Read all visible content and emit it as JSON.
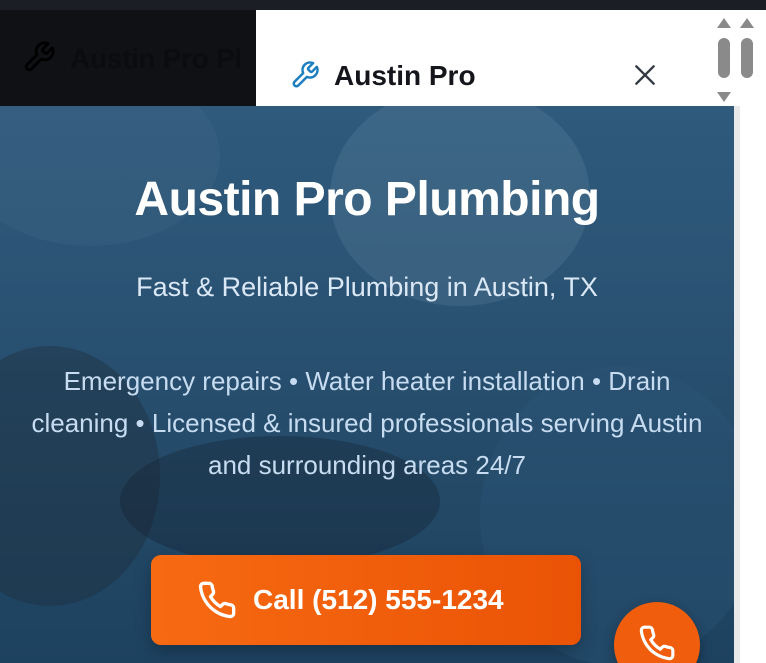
{
  "background_page": {
    "brand": "Austin Pro Pl"
  },
  "header": {
    "brand": "Austin Pro",
    "close_label": "close"
  },
  "hero": {
    "title": "Austin Pro Plumbing",
    "subtitle": "Fast & Reliable Plumbing in Austin, TX",
    "description": "Emergency repairs • Water heater installation • Drain cleaning • Licensed & insured professionals serving Austin and surrounding areas 24/7",
    "cta_label": "Call (512) 555-1234"
  },
  "icons": {
    "wrench": "wrench-icon",
    "close": "close-icon",
    "phone": "phone-icon"
  },
  "colors": {
    "accent_orange": "#f05d0c",
    "hero_blue": "#2a5273",
    "brand_icon_blue": "#1d7fc0"
  }
}
